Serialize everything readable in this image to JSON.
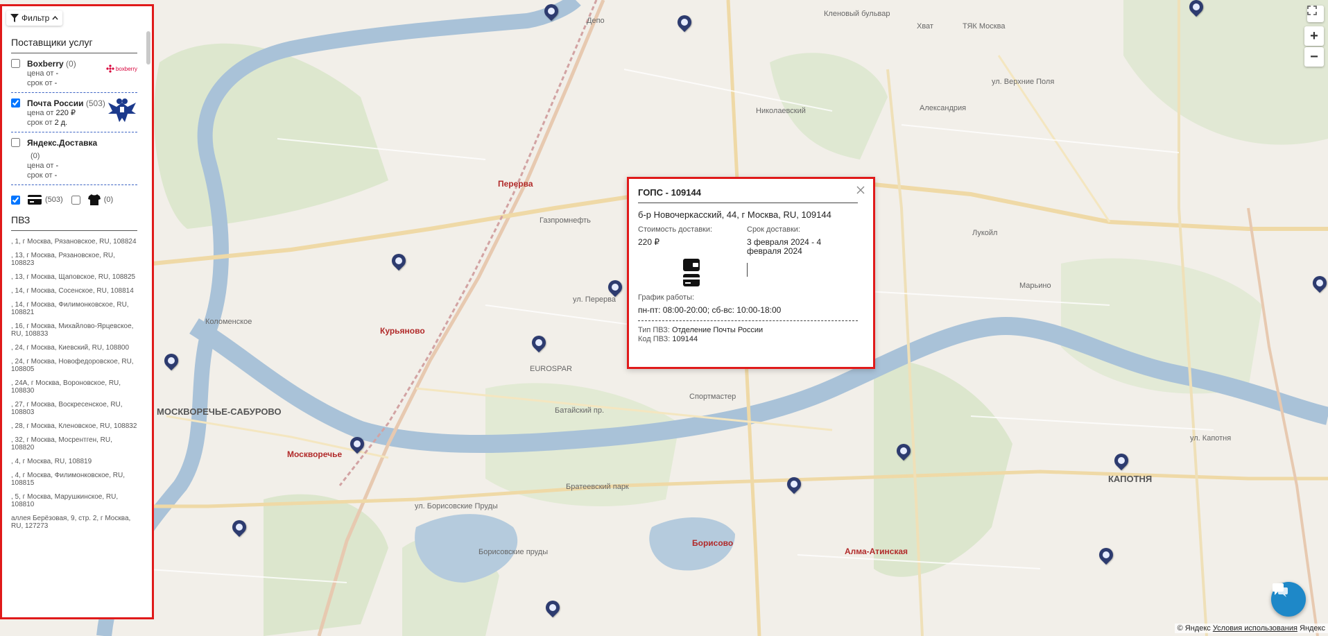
{
  "filter": {
    "label": "Фильтр"
  },
  "providers_section": {
    "title": "Поставщики услуг"
  },
  "providers": [
    {
      "name": "Boxberry",
      "count": "(0)",
      "checked": false,
      "price_label": "цена от",
      "price_value": "-",
      "term_label": "срок от",
      "term_value": "-",
      "logo_text": "boxberry",
      "logo_icon": "boxberry-logo"
    },
    {
      "name": "Почта России",
      "count": "(503)",
      "checked": true,
      "price_label": "цена от",
      "price_value": "220 ₽",
      "term_label": "срок от",
      "term_value": "2 д.",
      "logo_icon": "russian-post-eagle-logo"
    },
    {
      "name": "Яндекс.Доставка",
      "count": "(0)",
      "checked": false,
      "price_label": "цена от",
      "price_value": "-",
      "term_label": "срок от",
      "term_value": "-"
    }
  ],
  "types": [
    {
      "icon": "card-terminal-icon",
      "count": "(503)",
      "checked": true
    },
    {
      "icon": "tshirt-icon",
      "count": "(0)",
      "checked": false
    }
  ],
  "pvz_section": {
    "title": "ПВЗ"
  },
  "pvz_list": [
    ", 1, г Москва, Рязановское, RU, 108824",
    ", 13, г Москва, Рязановское, RU, 108823",
    ", 13, г Москва, Щаповское, RU, 108825",
    ", 14, г Москва, Сосенское, RU, 108814",
    ", 14, г Москва, Филимонковское, RU, 108821",
    ", 16, г Москва, Михайлово-Ярцевское, RU, 108833",
    ", 24, г Москва, Киевский, RU, 108800",
    ", 24, г Москва, Новофедоровское, RU, 108805",
    ", 24А, г Москва, Вороновское, RU, 108830",
    ", 27, г Москва, Воскресенское, RU, 108803",
    ", 28, г Москва, Кленовское, RU, 108832",
    ", 32, г Москва, Мосрентген, RU, 108820",
    ", 4, г Москва, RU, 108819",
    ", 4, г Москва, Филимонковское, RU, 108815",
    ", 5, г Москва, Марушкинское, RU, 108810",
    "аллея Берёзовая, 9, стр. 2, г Москва, RU, 127273"
  ],
  "popup": {
    "title": "ГОПС - 109144",
    "address": "б-р Новочеркасский, 44, г Москва, RU, 109144",
    "cost_label": "Стоимость доставки:",
    "cost_value": "220 ₽",
    "term_label": "Срок доставки:",
    "term_value": "3 февраля 2024 - 4 февраля 2024",
    "icon": "card-terminal-icon",
    "schedule_label": "График работы:",
    "schedule_value": "пн-пт: 08:00-20:00; сб-вс: 10:00-18:00",
    "type_label": "Тип ПВЗ:",
    "type_value": "Отделение Почты России",
    "code_label": "Код ПВЗ:",
    "code_value": "109144"
  },
  "map": {
    "labels": {
      "klen_bulvar": "Кленовый бульвар",
      "kolomenskoe": "Коломенское",
      "pererva": "Перерва",
      "kurianovo": "Курьяново",
      "moskvorechye": "Москворечье",
      "moskvorechye_saburovo": "МОСКВОРЕЧЬЕ-САБУРОВО",
      "maryino": "Марьино",
      "kapotnya": "КАПОТНЯ",
      "borisovo": "Борисово",
      "alma_atinskaya": "Алма-Атинская",
      "bratevo_park": "Братеевский парк",
      "borisovskie_prudy": "Борисовские пруды",
      "ul_pererva": "ул. Перерва",
      "batayskiy": "Батайский пр.",
      "borisovskie_prudy_st": "ул. Борисовские Пруды",
      "verkhnie_polya": "ул. Верхние Поля",
      "kapotnya_st": "ул. Капотня",
      "sportmaster": "Спортмастер",
      "eurospar": "EUROSPAR",
      "lukoil": "Лукойл",
      "gazpromneft": "Газпромнефть",
      "depo": "Депо",
      "nikolay": "Николаевский",
      "ekhat": "Хват",
      "tyak": "ТЯК Москва",
      "aleksandriya": "Александрия"
    },
    "footer_copyright": "© Яндекс",
    "footer_terms": "Условия использования",
    "footer_brand": "Яндекс",
    "zoom_in": "+",
    "zoom_out": "−"
  },
  "colors": {
    "highlight": "#e01a1a",
    "marker": "#2d3b6f",
    "river": "#a9c2d8",
    "park": "#c8dcb6",
    "chat": "#1e88c8",
    "divider": "#3b63c4"
  }
}
